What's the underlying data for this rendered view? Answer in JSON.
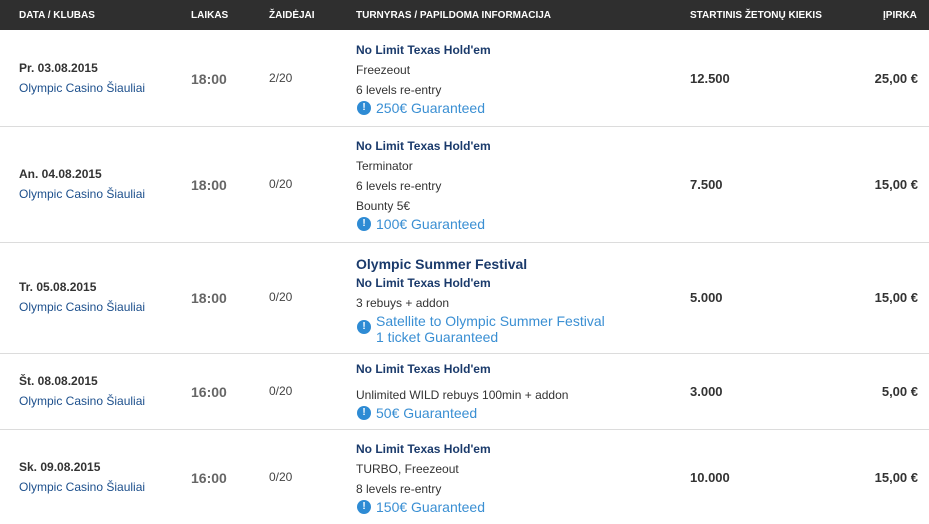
{
  "header": {
    "date_club": "DATA / KLUBAS",
    "time": "LAIKAS",
    "players": "ŽAIDĖJAI",
    "tournament": "TURNYRAS / PAPILDOMA INFORMACIJA",
    "chips": "STARTINIS ŽETONŲ KIEKIS",
    "buyin": "ĮPIRKA"
  },
  "rows": [
    {
      "date": "Pr. 03.08.2015",
      "club": "Olympic Casino Šiauliai",
      "time": "18:00",
      "players": "2/20",
      "game": "No Limit Texas Hold'em",
      "details": [
        "Freezeout",
        "6 levels re-entry"
      ],
      "guarantee": "250€ Guaranteed",
      "chips": "12.500",
      "buyin": "25,00 €"
    },
    {
      "date": "An. 04.08.2015",
      "club": "Olympic Casino Šiauliai",
      "time": "18:00",
      "players": "0/20",
      "game": "No Limit Texas Hold'em",
      "details": [
        "Terminator",
        "6 levels re-entry",
        "Bounty 5€"
      ],
      "guarantee": "100€ Guaranteed",
      "chips": "7.500",
      "buyin": "15,00 €"
    },
    {
      "date": "Tr. 05.08.2015",
      "club": "Olympic Casino Šiauliai",
      "time": "18:00",
      "players": "0/20",
      "festival": "Olympic Summer Festival",
      "game": "No Limit Texas Hold'em",
      "details": [
        "3 rebuys + addon"
      ],
      "guarantee_lines": [
        "Satellite to Olympic Summer Festival",
        "1 ticket Guaranteed"
      ],
      "chips": "5.000",
      "buyin": "15,00 €"
    },
    {
      "date": "Št. 08.08.2015",
      "club": "Olympic Casino Šiauliai",
      "time": "16:00",
      "players": "0/20",
      "game": "No Limit Texas Hold'em",
      "details": [
        "Unlimited WILD rebuys 100min + addon"
      ],
      "guarantee": "50€ Guaranteed",
      "chips": "3.000",
      "buyin": "5,00 €"
    },
    {
      "date": "Sk. 09.08.2015",
      "club": "Olympic Casino Šiauliai",
      "time": "16:00",
      "players": "0/20",
      "game": "No Limit Texas Hold'em",
      "details": [
        "TURBO, Freezeout",
        "8 levels re-entry"
      ],
      "guarantee": "150€ Guaranteed",
      "chips": "10.000",
      "buyin": "15,00 €"
    }
  ],
  "icons": {
    "guarantee_icon": "info-icon",
    "icon_glyph": "!",
    "icon_color": "#2e8bd4"
  }
}
